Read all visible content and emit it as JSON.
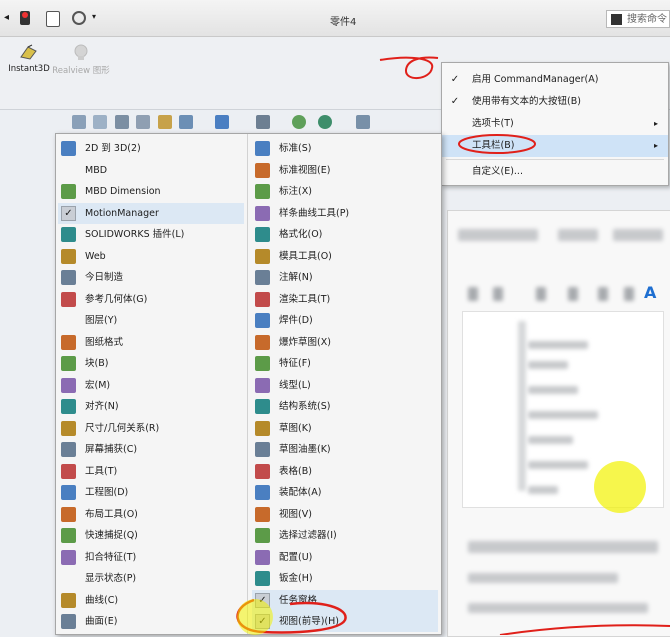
{
  "window": {
    "title": "零件4",
    "search_placeholder": "搜索命令"
  },
  "commandbar": {
    "buttons": [
      {
        "label": "Instant3D",
        "enabled": true
      },
      {
        "label": "Realview 图形",
        "enabled": false
      }
    ]
  },
  "context_menu": {
    "items": [
      {
        "label": "启用 CommandManager(A)",
        "checked": true,
        "submenu": false
      },
      {
        "label": "使用带有文本的大按钮(B)",
        "checked": true,
        "submenu": false
      },
      {
        "label": "选项卡(T)",
        "checked": false,
        "submenu": true
      },
      {
        "label": "工具栏(B)",
        "checked": false,
        "submenu": true
      },
      {
        "label": "自定义(E)...",
        "checked": false,
        "submenu": false
      }
    ]
  },
  "toolbar_menu": {
    "left": [
      {
        "label": "2D 到 3D(2)",
        "icon": "2d-to-3d-icon",
        "checked": false
      },
      {
        "label": "MBD",
        "icon": "",
        "checked": false
      },
      {
        "label": "MBD Dimension",
        "icon": "mbd-dimension-icon",
        "checked": false
      },
      {
        "label": "MotionManager",
        "icon": "",
        "checked": true
      },
      {
        "label": "SOLIDWORKS 插件(L)",
        "icon": "addins-icon",
        "checked": false
      },
      {
        "label": "Web",
        "icon": "web-icon",
        "checked": false
      },
      {
        "label": "今日制造",
        "icon": "folder-icon",
        "checked": false
      },
      {
        "label": "参考几何体(G)",
        "icon": "reference-geometry-icon",
        "checked": false
      },
      {
        "label": "图层(Y)",
        "icon": "",
        "checked": false
      },
      {
        "label": "图纸格式",
        "icon": "sheet-format-icon",
        "checked": false
      },
      {
        "label": "块(B)",
        "icon": "block-icon",
        "checked": false
      },
      {
        "label": "宏(M)",
        "icon": "macro-icon",
        "checked": false
      },
      {
        "label": "对齐(N)",
        "icon": "align-icon",
        "checked": false
      },
      {
        "label": "尺寸/几何关系(R)",
        "icon": "dimension-icon",
        "checked": false
      },
      {
        "label": "屏幕捕获(C)",
        "icon": "screen-capture-icon",
        "checked": false
      },
      {
        "label": "工具(T)",
        "icon": "tools-icon",
        "checked": false
      },
      {
        "label": "工程图(D)",
        "icon": "drawing-icon",
        "checked": false
      },
      {
        "label": "布局工具(O)",
        "icon": "layout-tools-icon",
        "checked": false
      },
      {
        "label": "快速捕捉(Q)",
        "icon": "quick-snaps-icon",
        "checked": false
      },
      {
        "label": "扣合特征(T)",
        "icon": "fastening-features-icon",
        "checked": false
      },
      {
        "label": "显示状态(P)",
        "icon": "",
        "checked": false
      },
      {
        "label": "曲线(C)",
        "icon": "curves-icon",
        "checked": false
      },
      {
        "label": "曲面(E)",
        "icon": "surfaces-icon",
        "checked": false
      }
    ],
    "right": [
      {
        "label": "标准(S)",
        "icon": "standard-icon",
        "checked": false
      },
      {
        "label": "标准视图(E)",
        "icon": "standard-views-icon",
        "checked": false
      },
      {
        "label": "标注(X)",
        "icon": "annotation-icon",
        "checked": false
      },
      {
        "label": "样条曲线工具(P)",
        "icon": "spline-tools-icon",
        "checked": false
      },
      {
        "label": "格式化(O)",
        "icon": "format-icon",
        "checked": false
      },
      {
        "label": "模具工具(O)",
        "icon": "mold-tools-icon",
        "checked": false
      },
      {
        "label": "注解(N)",
        "icon": "notes-icon",
        "checked": false
      },
      {
        "label": "渲染工具(T)",
        "icon": "render-tools-icon",
        "checked": false
      },
      {
        "label": "焊件(D)",
        "icon": "weldments-icon",
        "checked": false
      },
      {
        "label": "爆炸草图(X)",
        "icon": "explode-sketch-icon",
        "checked": false
      },
      {
        "label": "特征(F)",
        "icon": "features-icon",
        "checked": false
      },
      {
        "label": "线型(L)",
        "icon": "line-format-icon",
        "checked": false
      },
      {
        "label": "结构系统(S)",
        "icon": "structure-system-icon",
        "checked": false
      },
      {
        "label": "草图(K)",
        "icon": "sketch-icon",
        "checked": false
      },
      {
        "label": "草图油墨(K)",
        "icon": "sketch-ink-icon",
        "checked": false
      },
      {
        "label": "表格(B)",
        "icon": "table-icon",
        "checked": false
      },
      {
        "label": "装配体(A)",
        "icon": "assembly-icon",
        "checked": false
      },
      {
        "label": "视图(V)",
        "icon": "view-icon",
        "checked": false
      },
      {
        "label": "选择过滤器(I)",
        "icon": "selection-filter-icon",
        "checked": false
      },
      {
        "label": "配置(U)",
        "icon": "configurations-icon",
        "checked": false
      },
      {
        "label": "钣金(H)",
        "icon": "sheet-metal-icon",
        "checked": false
      },
      {
        "label": "任务窗格",
        "icon": "",
        "checked": true
      },
      {
        "label": "视图(前导)(H)",
        "icon": "",
        "checked": true
      }
    ]
  },
  "right_panel": {
    "text_icon": "A"
  },
  "colors": {
    "accent_blue": "#1f6fd1",
    "annotation_red": "#e0201a",
    "highlight_yellow": "#f2f200"
  }
}
